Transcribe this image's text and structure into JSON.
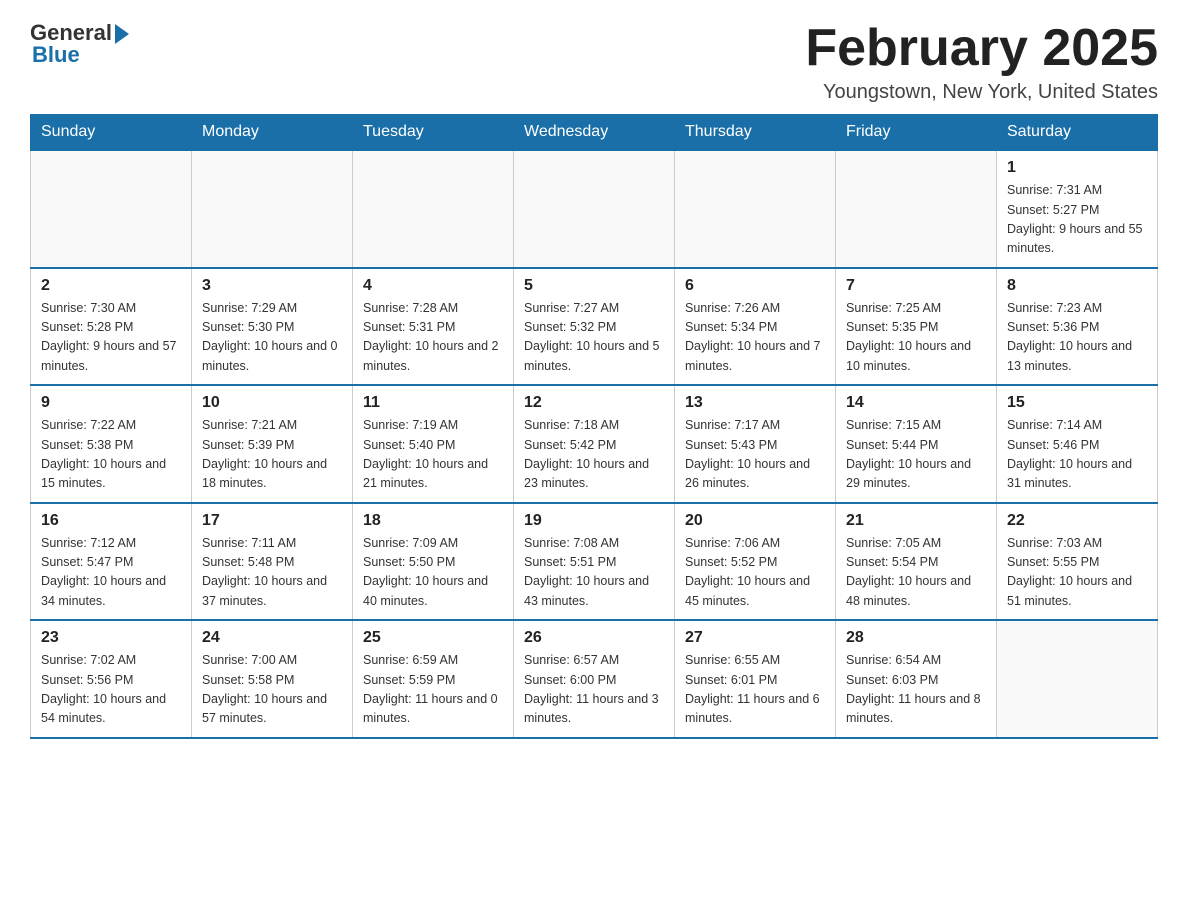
{
  "header": {
    "logo_general": "General",
    "logo_blue": "Blue",
    "title": "February 2025",
    "location": "Youngstown, New York, United States"
  },
  "days_of_week": [
    "Sunday",
    "Monday",
    "Tuesday",
    "Wednesday",
    "Thursday",
    "Friday",
    "Saturday"
  ],
  "weeks": [
    [
      {
        "day": "",
        "info": ""
      },
      {
        "day": "",
        "info": ""
      },
      {
        "day": "",
        "info": ""
      },
      {
        "day": "",
        "info": ""
      },
      {
        "day": "",
        "info": ""
      },
      {
        "day": "",
        "info": ""
      },
      {
        "day": "1",
        "info": "Sunrise: 7:31 AM\nSunset: 5:27 PM\nDaylight: 9 hours and 55 minutes."
      }
    ],
    [
      {
        "day": "2",
        "info": "Sunrise: 7:30 AM\nSunset: 5:28 PM\nDaylight: 9 hours and 57 minutes."
      },
      {
        "day": "3",
        "info": "Sunrise: 7:29 AM\nSunset: 5:30 PM\nDaylight: 10 hours and 0 minutes."
      },
      {
        "day": "4",
        "info": "Sunrise: 7:28 AM\nSunset: 5:31 PM\nDaylight: 10 hours and 2 minutes."
      },
      {
        "day": "5",
        "info": "Sunrise: 7:27 AM\nSunset: 5:32 PM\nDaylight: 10 hours and 5 minutes."
      },
      {
        "day": "6",
        "info": "Sunrise: 7:26 AM\nSunset: 5:34 PM\nDaylight: 10 hours and 7 minutes."
      },
      {
        "day": "7",
        "info": "Sunrise: 7:25 AM\nSunset: 5:35 PM\nDaylight: 10 hours and 10 minutes."
      },
      {
        "day": "8",
        "info": "Sunrise: 7:23 AM\nSunset: 5:36 PM\nDaylight: 10 hours and 13 minutes."
      }
    ],
    [
      {
        "day": "9",
        "info": "Sunrise: 7:22 AM\nSunset: 5:38 PM\nDaylight: 10 hours and 15 minutes."
      },
      {
        "day": "10",
        "info": "Sunrise: 7:21 AM\nSunset: 5:39 PM\nDaylight: 10 hours and 18 minutes."
      },
      {
        "day": "11",
        "info": "Sunrise: 7:19 AM\nSunset: 5:40 PM\nDaylight: 10 hours and 21 minutes."
      },
      {
        "day": "12",
        "info": "Sunrise: 7:18 AM\nSunset: 5:42 PM\nDaylight: 10 hours and 23 minutes."
      },
      {
        "day": "13",
        "info": "Sunrise: 7:17 AM\nSunset: 5:43 PM\nDaylight: 10 hours and 26 minutes."
      },
      {
        "day": "14",
        "info": "Sunrise: 7:15 AM\nSunset: 5:44 PM\nDaylight: 10 hours and 29 minutes."
      },
      {
        "day": "15",
        "info": "Sunrise: 7:14 AM\nSunset: 5:46 PM\nDaylight: 10 hours and 31 minutes."
      }
    ],
    [
      {
        "day": "16",
        "info": "Sunrise: 7:12 AM\nSunset: 5:47 PM\nDaylight: 10 hours and 34 minutes."
      },
      {
        "day": "17",
        "info": "Sunrise: 7:11 AM\nSunset: 5:48 PM\nDaylight: 10 hours and 37 minutes."
      },
      {
        "day": "18",
        "info": "Sunrise: 7:09 AM\nSunset: 5:50 PM\nDaylight: 10 hours and 40 minutes."
      },
      {
        "day": "19",
        "info": "Sunrise: 7:08 AM\nSunset: 5:51 PM\nDaylight: 10 hours and 43 minutes."
      },
      {
        "day": "20",
        "info": "Sunrise: 7:06 AM\nSunset: 5:52 PM\nDaylight: 10 hours and 45 minutes."
      },
      {
        "day": "21",
        "info": "Sunrise: 7:05 AM\nSunset: 5:54 PM\nDaylight: 10 hours and 48 minutes."
      },
      {
        "day": "22",
        "info": "Sunrise: 7:03 AM\nSunset: 5:55 PM\nDaylight: 10 hours and 51 minutes."
      }
    ],
    [
      {
        "day": "23",
        "info": "Sunrise: 7:02 AM\nSunset: 5:56 PM\nDaylight: 10 hours and 54 minutes."
      },
      {
        "day": "24",
        "info": "Sunrise: 7:00 AM\nSunset: 5:58 PM\nDaylight: 10 hours and 57 minutes."
      },
      {
        "day": "25",
        "info": "Sunrise: 6:59 AM\nSunset: 5:59 PM\nDaylight: 11 hours and 0 minutes."
      },
      {
        "day": "26",
        "info": "Sunrise: 6:57 AM\nSunset: 6:00 PM\nDaylight: 11 hours and 3 minutes."
      },
      {
        "day": "27",
        "info": "Sunrise: 6:55 AM\nSunset: 6:01 PM\nDaylight: 11 hours and 6 minutes."
      },
      {
        "day": "28",
        "info": "Sunrise: 6:54 AM\nSunset: 6:03 PM\nDaylight: 11 hours and 8 minutes."
      },
      {
        "day": "",
        "info": ""
      }
    ]
  ]
}
